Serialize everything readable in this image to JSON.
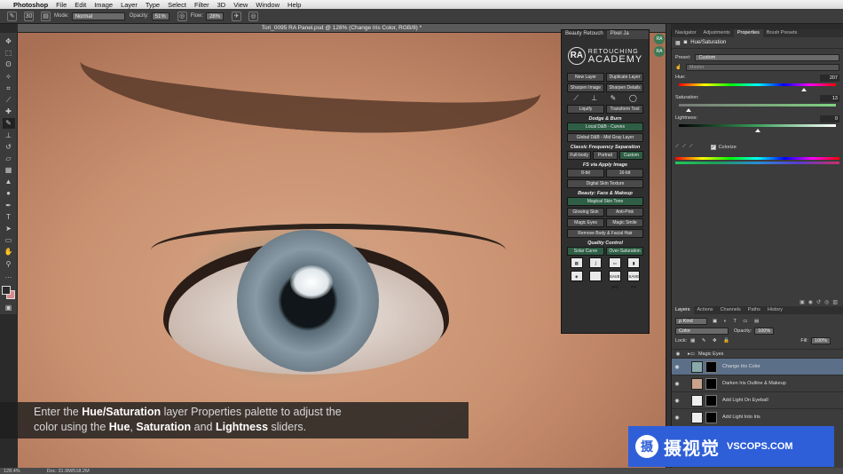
{
  "menubar": {
    "apple": "",
    "items": [
      "Photoshop",
      "File",
      "Edit",
      "Image",
      "Layer",
      "Type",
      "Select",
      "Filter",
      "3D",
      "View",
      "Window",
      "Help"
    ]
  },
  "options": {
    "brush_size": "30",
    "mode_label": "Mode:",
    "mode_value": "Normal",
    "opacity_label": "Opacity:",
    "opacity_value": "51%",
    "flow_label": "Flow:",
    "flow_value": "28%"
  },
  "document": {
    "title": "Tori_0095 RA Panel.psd @ 128% (Change Iris Color, RGB/8) *"
  },
  "caption": {
    "line1_a": "Enter the ",
    "line1_b": "Hue/Saturation",
    "line1_c": " layer Properties palette to adjust the",
    "line2_a": "color using the ",
    "line2_b": "Hue",
    "line2_c": ", ",
    "line2_d": "Saturation",
    "line2_e": " and ",
    "line2_f": "Lightness",
    "line2_g": " sliders."
  },
  "status": {
    "zoom": "128.4%",
    "doc": "Doc: 31.9M/518.2M"
  },
  "ra_panel": {
    "tabs": [
      "Beauty Retouch",
      "Pixel Ja"
    ],
    "logo_mono": "RA",
    "logo_top": "RETOUCHING",
    "logo_bottom": "ACADEMY",
    "row1": [
      "New Layer",
      "Duplicate Layer"
    ],
    "row2": [
      "Sharpen Image",
      "Sharpen Details"
    ],
    "row3": [
      "Liquify",
      "Transform Tool"
    ],
    "sec_dodge": "Dodge & Burn",
    "dodge1": "Local D&B - Curves",
    "dodge2": "Global D&B - Mid Gray Layer",
    "sec_freq": "Classic Frequency Separation",
    "freq": [
      "Full-body",
      "Portrait",
      "Custom"
    ],
    "sec_fs": "FS via Apply Image",
    "fs": [
      "8-bit",
      "16-bit"
    ],
    "skin_texture": "Digital Skin Texture",
    "sec_beauty": "Beauty: Face & Makeup",
    "magical_skin": "Magical Skin Tone",
    "beauty1": [
      "Glowing Skin",
      "Anti-Pink"
    ],
    "beauty2": [
      "Magic Eyes",
      "Magic Smile"
    ],
    "remove_body": "Remove Body & Facial Hair",
    "sec_quality": "Quality Control",
    "quality": [
      "Solar Curve",
      "Over-Saturation"
    ],
    "icons_row2": [
      "",
      "SAVE JPG",
      "SAVE PS"
    ]
  },
  "mini_ra": [
    "RA",
    "RA"
  ],
  "props": {
    "tabs": [
      "Navigator",
      "Adjustments",
      "Properties",
      "Brush Presets"
    ],
    "header": "Hue/Saturation",
    "preset_label": "Preset:",
    "preset_value": "Custom",
    "channel_value": "Master",
    "hue_label": "Hue:",
    "hue_value": "207",
    "sat_label": "Saturation:",
    "sat_value": "13",
    "light_label": "Lightness:",
    "light_value": "0",
    "colorize_label": "Colorize",
    "hue_fraction": 0.79,
    "sat_fraction": 0.06,
    "light_fraction": 0.5
  },
  "layers": {
    "tabs": [
      "Layers",
      "Actions",
      "Channels",
      "Paths",
      "History"
    ],
    "kind_value": "ρ Kind",
    "blend_value": "Color",
    "opacity_label": "Opacity:",
    "opacity_value": "100%",
    "lock_label": "Lock:",
    "fill_label": "Fill:",
    "fill_value": "100%",
    "group_name": "Magic Eyes",
    "items": [
      "Change Iris Color",
      "Darken Iris Outline & Makeup",
      "Add Light On Eyeball",
      "Add Light Into Iris"
    ]
  },
  "watermark": {
    "logo": "摄",
    "cn": "摄视觉",
    "en": "VSCOPS.COM"
  }
}
